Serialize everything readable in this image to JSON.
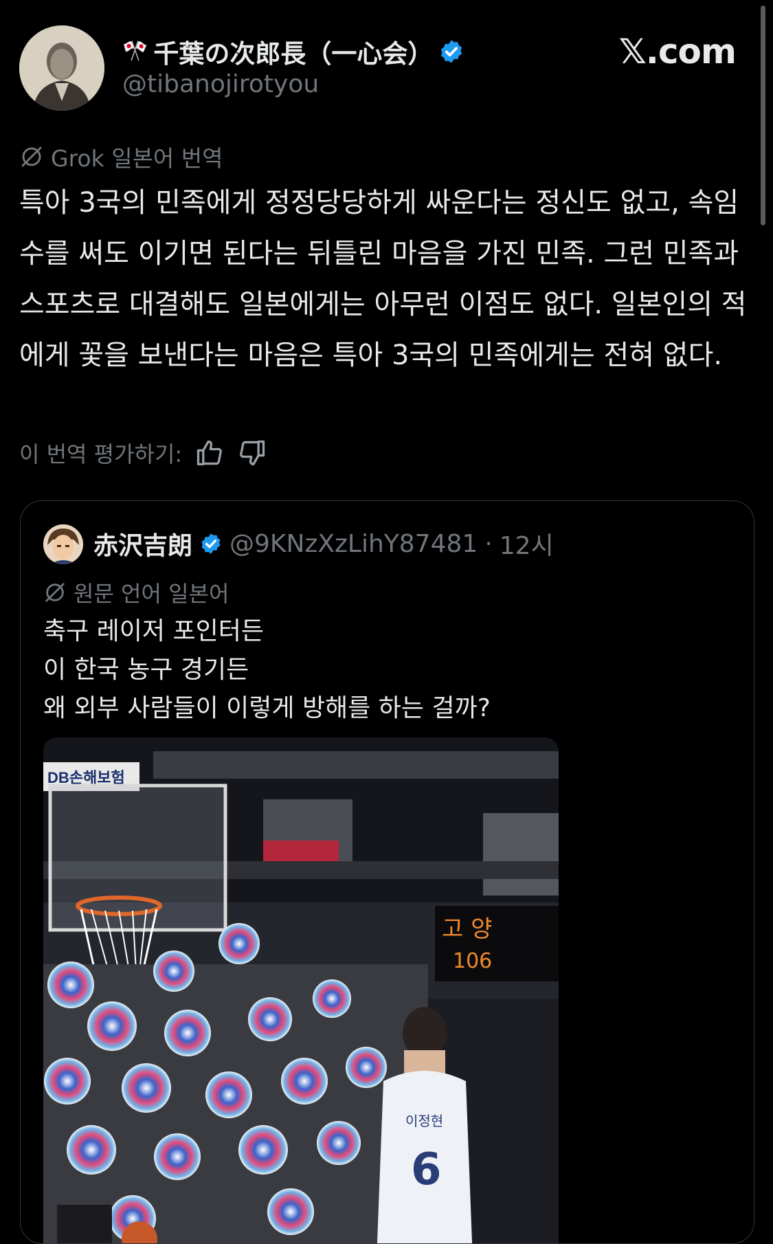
{
  "tweet": {
    "flags": "🎌",
    "display_name": "千葉の次郎長（一心会）",
    "handle": "@tibanojirotyou",
    "site_logo": "𝕏.com",
    "grok_label": "Grok 일본어 번역",
    "text": "특아 3국의 민족에게 정정당당하게 싸운다는 정신도 없고, 속임수를 써도 이기면 된다는 뒤틀린 마음을 가진 민족. 그런 민족과 스포츠로 대결해도 일본에게는 아무런 이점도 없다. 일본인의 적에게 꽃을 보낸다는 마음은 특아 3국의 민족에게는 전혀 없다.",
    "rate_label": "이 번역 평가하기:"
  },
  "quote": {
    "display_name": "赤沢吉朗",
    "handle": "@9KNzXzLihY87481",
    "separator": "·",
    "time": "12시",
    "lang_label": "원문 언어 일본어",
    "text": "축구 레이저 포인터든\n이 한국 농구 경기든\n왜 외부 사람들이 이렇게 방해를 하는 걸까?",
    "media": {
      "sponsor": "DB손해보험",
      "scoreboard_team": "고 양",
      "scoreboard_score": "106",
      "player_name": "이정현",
      "jersey_number": "6"
    }
  },
  "colors": {
    "background": "#000000",
    "text": "#e7e9ea",
    "secondary": "#71767b",
    "verified": "#1d9bf0",
    "border": "#333639"
  },
  "icons": [
    "avatar-portrait",
    "verified-badge-icon",
    "grok-icon",
    "thumbs-up-icon",
    "thumbs-down-icon"
  ]
}
